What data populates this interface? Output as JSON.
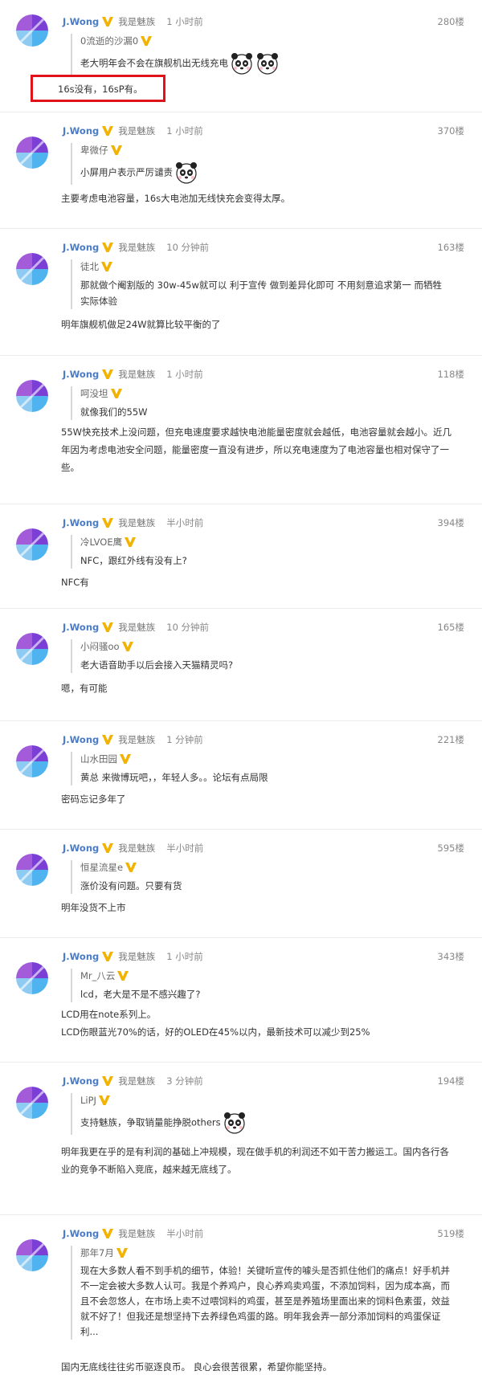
{
  "user": {
    "name": "J.Wong",
    "affiliation": "我是魅族"
  },
  "colors": {
    "username": "#4a7cc6",
    "vbadge": "#f2b200",
    "highlight_border": "#e0131a"
  },
  "posts": [
    {
      "time": "1 小时前",
      "floor": "280楼",
      "quote_user": "0流逝的沙漏0",
      "quote_text": "老大明年会不会在旗舰机出无线充电",
      "reply": "16s没有，16sP有。"
    },
    {
      "time": "1 小时前",
      "floor": "370楼",
      "quote_user": "卑微仔",
      "quote_text": "小屏用户表示严厉谴责",
      "reply": "主要考虑电池容量，16s大电池加无线快充会变得太厚。"
    },
    {
      "time": "10 分钟前",
      "floor": "163楼",
      "quote_user": "徒北",
      "quote_text": "那就做个阉割版的 30w-45w就可以 利于宣传 做到差异化即可 不用刻意追求第一 而牺牲实际体验",
      "reply": "明年旗舰机做足24W就算比较平衡的了"
    },
    {
      "time": "1 小时前",
      "floor": "118楼",
      "quote_user": "呵没坦",
      "quote_text": "就像我们的55W",
      "reply": "55W快充技术上没问题，但充电速度要求越快电池能量密度就会越低，电池容量就会越小。近几年因为考虑电池安全问题，能量密度一直没有进步，所以充电速度为了电池容量也相对保守了一些。"
    },
    {
      "time": "半小时前",
      "floor": "394楼",
      "quote_user": "冷LVOE鹰",
      "quote_text": "NFC，跟红外线有没有上?",
      "reply": "NFC有"
    },
    {
      "time": "10 分钟前",
      "floor": "165楼",
      "quote_user": "小闷骚oo",
      "quote_text": "老大语音助手以后会接入天猫精灵吗?",
      "reply": "嗯，有可能"
    },
    {
      "time": "1 分钟前",
      "floor": "221楼",
      "quote_user": "山水田园",
      "quote_text": "黄总 来微博玩吧，，年轻人多。。论坛有点局限",
      "reply": "密码忘记多年了"
    },
    {
      "time": "半小时前",
      "floor": "595楼",
      "quote_user": "恒星流星e",
      "quote_text": "涨价没有问题。只要有货",
      "reply": "明年没货不上市"
    },
    {
      "time": "1 小时前",
      "floor": "343楼",
      "quote_user": "Mr_八云",
      "quote_text": "lcd，老大是不是不感兴趣了?",
      "reply": "LCD用在note系列上。",
      "reply2": "LCD伤眼蓝光70%的话，好的OLED在45%以内，最新技术可以减少到25%"
    },
    {
      "time": "3 分钟前",
      "floor": "194楼",
      "quote_user": "LiPJ",
      "quote_text": "支持魅族，争取销量能挣脱others",
      "reply": "明年我更在乎的是有利润的基础上冲规模，现在做手机的利润还不如干苦力搬运工。国内各行各业的竞争不断陷入竞底，越来越无底线了。"
    },
    {
      "time": "半小时前",
      "floor": "519楼",
      "quote_user": "那年7月",
      "quote_text": "现在大多数人看不到手机的细节，体验！关键听宣传的噱头是否抓住他们的痛点！好手机并不一定会被大多数人认可。我是个养鸡户，良心养鸡卖鸡蛋，不添加饲料，因为成本高，而且不会忽悠人，在市场上卖不过喂饲料的鸡蛋，甚至是养殖场里面出来的饲料色素蛋，效益就不好了！但我还是想坚持下去养绿色鸡蛋的路。明年我会弄一部分添加饲料的鸡蛋保证利...",
      "reply": "国内无底线往往劣币驱逐良币。 良心会很苦很累，希望你能坚持。"
    }
  ]
}
